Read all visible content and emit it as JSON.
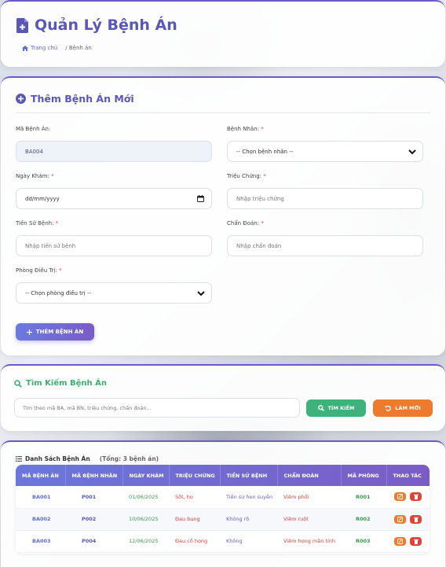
{
  "header": {
    "title": "Quản Lý Bệnh Án",
    "breadcrumb_home": "Trang chủ",
    "breadcrumb_current": "/ Bệnh án"
  },
  "form": {
    "title": "Thêm Bệnh Án Mới",
    "ma_benh_an": {
      "label": "Mã Bệnh Án:",
      "value": "BA004"
    },
    "benh_nhan": {
      "label": "Bệnh Nhân:",
      "required": "*",
      "selected": "-- Chọn bệnh nhân --"
    },
    "ngay_kham": {
      "label": "Ngày Khám:",
      "required": "*",
      "placeholder": "dd/mm/yyyy"
    },
    "trieu_chung": {
      "label": "Triệu Chứng:",
      "required": "*",
      "placeholder": "Nhập triệu chứng"
    },
    "tien_su_benh": {
      "label": "Tiền Sử Bệnh:",
      "required": "*",
      "placeholder": "Nhập tiền sử bệnh"
    },
    "chan_doan": {
      "label": "Chẩn Đoán:",
      "required": "*",
      "placeholder": "Nhập chẩn đoán"
    },
    "phong_dieu_tri": {
      "label": "Phòng Điều Trị:",
      "required": "*",
      "selected": "-- Chọn phòng điều trị --"
    },
    "submit_label": "THÊM BỆNH ÁN"
  },
  "search": {
    "title": "Tìm Kiếm Bệnh Án",
    "placeholder": "Tìm theo mã BA, mã BN, triệu chứng, chẩn đoán...",
    "search_label": "TÌM KIẾM",
    "reset_label": "LÀM MỚI"
  },
  "list": {
    "title": "Danh Sách Bệnh Án",
    "total": "(Tổng: 3 bệnh án)",
    "columns": [
      "MÃ BỆNH ÁN",
      "MÃ BỆNH NHÂN",
      "NGÀY KHÁM",
      "TRIỆU CHỨNG",
      "TIỀN SỬ BỆNH",
      "CHẨN ĐOÁN",
      "MÃ PHÒNG",
      "THAO TÁC"
    ],
    "rows": [
      {
        "ma_ba": "BA001",
        "ma_bn": "P001",
        "ngay": "01/06/2025",
        "trieu_chung": "Sốt, ho",
        "tien_su": "Tiền sử hen suyễn",
        "chan_doan": "Viêm phổi",
        "phong": "R001"
      },
      {
        "ma_ba": "BA002",
        "ma_bn": "P002",
        "ngay": "10/06/2025",
        "trieu_chung": "Đau bụng",
        "tien_su": "Không rõ",
        "chan_doan": "Viêm ruột",
        "phong": "R002"
      },
      {
        "ma_ba": "BA003",
        "ma_bn": "P004",
        "ngay": "12/06/2025",
        "trieu_chung": "Đau cổ họng",
        "tien_su": "Không",
        "chan_doan": "Viêm họng mãn tính",
        "phong": "R003"
      }
    ]
  },
  "colors": {
    "primary": "#5b57b8",
    "success": "#3db27a",
    "warning": "#ee7a2e",
    "danger": "#e0433a"
  }
}
